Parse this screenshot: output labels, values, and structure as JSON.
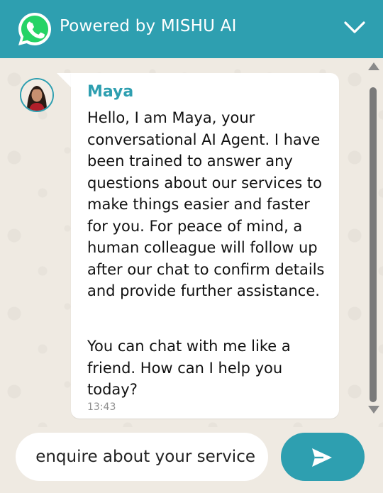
{
  "header": {
    "title": "Powered by MISHU AI",
    "whatsapp_icon": "whatsapp-icon",
    "collapse_icon": "chevron-down-icon"
  },
  "message": {
    "sender": "Maya",
    "paragraph1": "Hello, I am Maya, your conversational AI Agent. I have been trained to answer any questions about our services to make things easier and faster for you. For peace of mind, a human colleague will follow up after our chat to confirm details and provide further assistance.",
    "paragraph2": "You can chat with me like a friend. How can I help you today?",
    "time": "13:43"
  },
  "composer": {
    "input_value": "I would like to enquire about your service",
    "send_icon": "send-icon"
  },
  "colors": {
    "accent": "#2e9fb0",
    "chat_background": "#efeae2",
    "bubble": "#ffffff",
    "whatsapp_green": "#25d366"
  }
}
